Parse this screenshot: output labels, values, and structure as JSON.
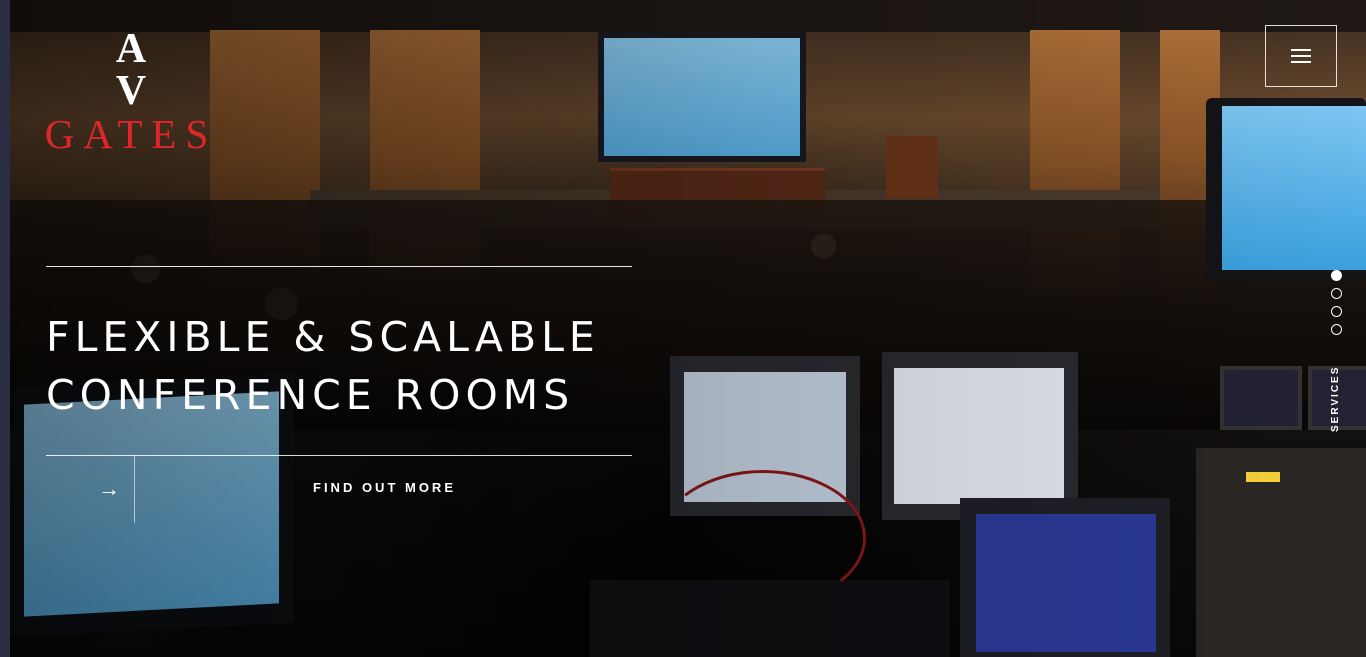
{
  "brand": {
    "logo_top": "A V",
    "logo_bottom": "GATES",
    "logo_accent_color": "#e0262c"
  },
  "header": {
    "menu_icon": "hamburger-menu-icon"
  },
  "hero": {
    "title_line1": "FLEXIBLE & SCALABLE",
    "title_line2": "CONFERENCE ROOMS",
    "arrow_icon": "→",
    "cta_label": "FIND OUT MORE"
  },
  "slider": {
    "dots": 4,
    "active_index": 0,
    "side_label": "SERVICES"
  }
}
